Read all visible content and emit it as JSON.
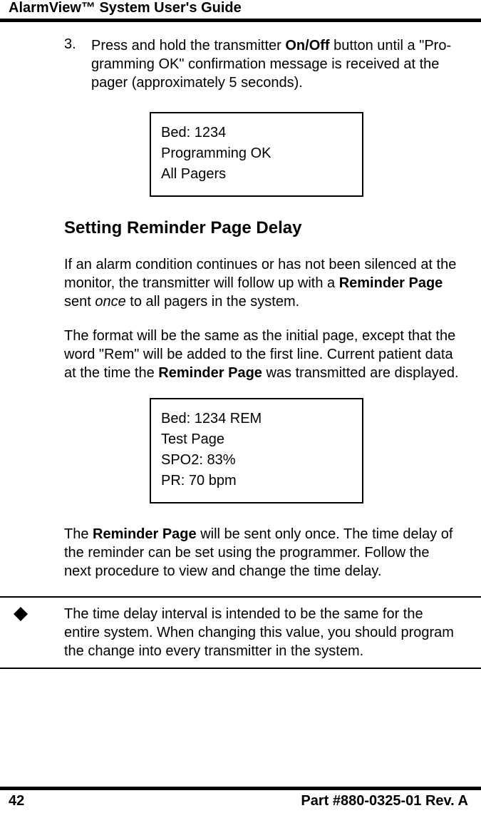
{
  "header": {
    "title": "AlarmView™ System User's Guide"
  },
  "step3": {
    "num": "3.",
    "pre": "Press and hold the transmitter ",
    "bold": "On/Off",
    "post": " button until a \"Pro-gramming OK\" confirmation message is received at the pager (approximately 5 seconds)."
  },
  "box1": {
    "l1": "Bed: 1234",
    "l2": "Programming OK",
    "l3": "All Pagers"
  },
  "section": {
    "heading": "Setting Reminder Page Delay"
  },
  "para1": {
    "pre": "If an alarm condition continues or has not been silenced at the monitor, the transmitter will follow up with a ",
    "bold": "Reminder Page",
    "mid": " sent ",
    "italic": "once",
    "post": " to all pagers in the system."
  },
  "para2": {
    "pre": "The format will be the same as the initial page, except that the word \"Rem\" will be added to the first line. Current patient data at the time the ",
    "bold": "Reminder Page",
    "post": " was transmitted are displayed."
  },
  "box2": {
    "l1": "Bed: 1234 REM",
    "l2": "Test Page",
    "l3": "SPO2: 83%",
    "l4": "PR: 70 bpm"
  },
  "para3": {
    "pre": "The ",
    "bold": "Reminder Page",
    "post": " will be sent only once. The time delay of the reminder can be set using the programmer. Follow the next procedure to view and change the time delay."
  },
  "note": {
    "text": " The time delay interval is intended to be the same for the entire system. When changing this value, you should program the change into every transmitter in the system."
  },
  "footer": {
    "page": "42",
    "part": "Part #880-0325-01 Rev. A"
  }
}
